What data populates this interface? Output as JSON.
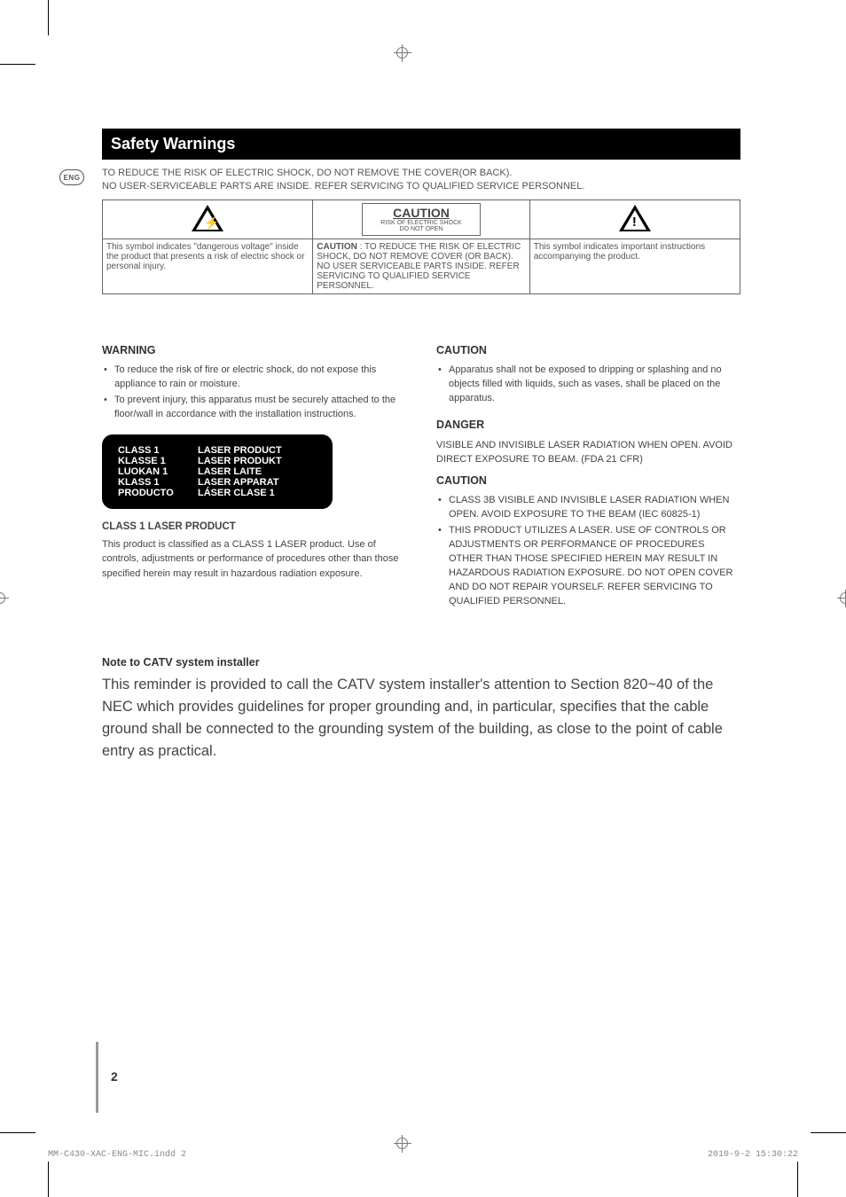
{
  "lang_badge": "ENG",
  "title": "Safety Warnings",
  "intro": {
    "line1": "TO REDUCE THE RISK OF ELECTRIC SHOCK, DO NOT REMOVE THE COVER(OR BACK).",
    "line2": "NO USER-SERVICEABLE PARTS ARE INSIDE. REFER SERVICING TO QUALIFIED SERVICE PERSONNEL."
  },
  "caution_box": {
    "label_big": "CAUTION",
    "label_small1": "RISK OF ELECTRIC SHOCK",
    "label_small2": "DO NOT OPEN",
    "col1": "This symbol indicates \"dangerous voltage\" inside the product that presents a risk of electric shock or personal injury.",
    "col2_bold": "CAUTION",
    "col2_rest": " : TO REDUCE THE RISK OF ELECTRIC SHOCK, DO NOT REMOVE COVER (OR BACK). NO USER SERVICEABLE PARTS INSIDE. REFER SERVICING TO QUALIFIED SERVICE PERSONNEL.",
    "col3": "This symbol indicates important instructions accompanying the product."
  },
  "left": {
    "warning_head": "WARNING",
    "warning_items": [
      "To reduce the risk of fire or electric shock, do not expose this appliance to rain or moisture.",
      "To prevent injury, this apparatus must be securely attached to the floor/wall in accordance with the installation instructions."
    ],
    "laser_rows": [
      {
        "l": "CLASS 1",
        "r": "LASER PRODUCT"
      },
      {
        "l": "KLASSE 1",
        "r": "LASER PRODUKT"
      },
      {
        "l": "LUOKAN 1",
        "r": "LASER LAITE"
      },
      {
        "l": "KLASS 1",
        "r": "LASER APPARAT"
      },
      {
        "l": "PRODUCTO",
        "r": "LÁSER CLASE 1"
      }
    ],
    "class1_head": "CLASS 1 LASER PRODUCT",
    "class1_body": "This product is classified as a CLASS 1 LASER product. Use of controls, adjustments or performance of procedures other than those specified herein may result in hazardous radiation exposure."
  },
  "right": {
    "caution1_head": "CAUTION",
    "caution1_items": [
      "Apparatus shall not be exposed to dripping or splashing and no objects filled with liquids, such as vases, shall be placed on the apparatus."
    ],
    "danger_head": "DANGER",
    "danger_body": "VISIBLE AND INVISIBLE LASER RADIATION WHEN OPEN. AVOID DIRECT EXPOSURE TO BEAM. (FDA 21 CFR)",
    "caution2_head": "CAUTION",
    "caution2_items": [
      "CLASS 3B VISIBLE AND INVISIBLE LASER RADIATION WHEN OPEN. AVOID EXPOSURE TO THE BEAM (IEC 60825-1)",
      "THIS PRODUCT UTILIZES A LASER. USE OF CONTROLS OR ADJUSTMENTS OR PERFORMANCE OF PROCEDURES OTHER THAN THOSE SPECIFIED HEREIN MAY RESULT IN HAZARDOUS RADIATION EXPOSURE. DO NOT OPEN COVER AND DO NOT REPAIR YOURSELF. REFER SERVICING TO QUALIFIED PERSONNEL."
    ]
  },
  "note": {
    "head": "Note to CATV system installer",
    "body": "This reminder is provided to call the CATV system installer's attention to Section 820~40 of the NEC which provides guidelines for proper grounding and, in particular, specifies that the cable ground shall be connected to the grounding system of the building, as close to the point of cable entry as practical."
  },
  "page_number": "2",
  "footer_left": "MM-C430-XAC-ENG-MIC.indd   2",
  "footer_right": "2010-9-2   15:30:22"
}
